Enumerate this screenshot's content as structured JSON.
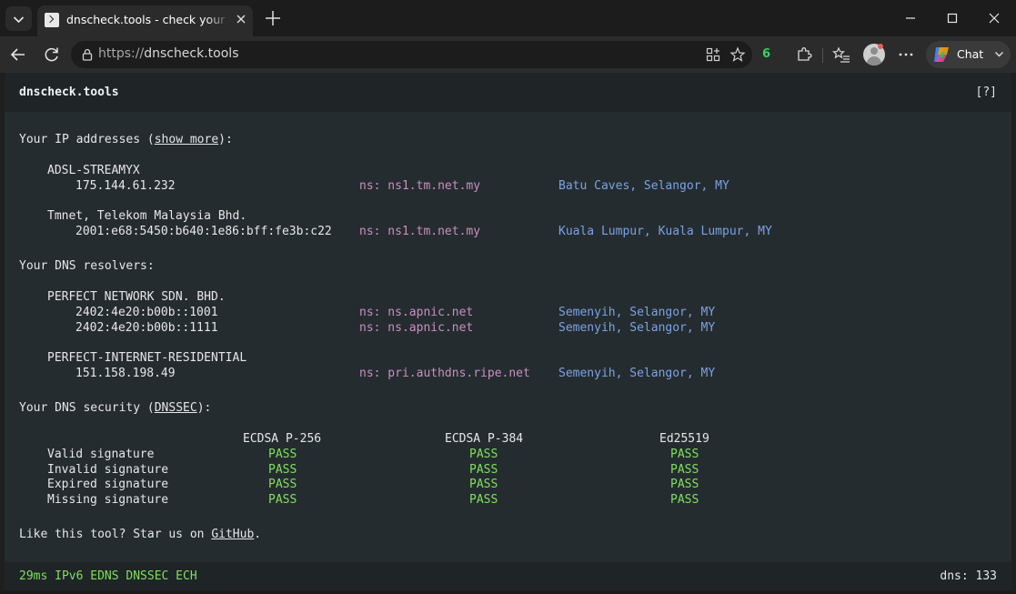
{
  "browser": {
    "tab_title": "dnscheck.tools - check your dns resolvers",
    "url_scheme": "https://",
    "url_host": "dnscheck.tools",
    "extension_badge": "6",
    "chat_label": "Chat"
  },
  "site": {
    "title": "dnscheck.tools",
    "help": "[?]"
  },
  "ip_section": {
    "heading_prefix": "Your IP addresses (",
    "heading_link": "show more",
    "heading_suffix": "):",
    "groups": [
      {
        "org": "ADSL-STREAMYX",
        "entries": [
          {
            "addr": "175.144.61.232",
            "ns": "ns: ns1.tm.net.my",
            "location": "Batu Caves, Selangor, MY"
          }
        ]
      },
      {
        "org": "Tmnet, Telekom Malaysia Bhd.",
        "entries": [
          {
            "addr": "2001:e68:5450:b640:1e86:bff:fe3b:c22",
            "ns": "ns: ns1.tm.net.my",
            "location": "Kuala Lumpur, Kuala Lumpur, MY"
          }
        ]
      }
    ]
  },
  "resolver_section": {
    "heading": "Your DNS resolvers:",
    "groups": [
      {
        "org": "PERFECT NETWORK SDN. BHD.",
        "entries": [
          {
            "addr": "2402:4e20:b00b::1001",
            "ns": "ns: ns.apnic.net",
            "location": "Semenyih, Selangor, MY"
          },
          {
            "addr": "2402:4e20:b00b::1111",
            "ns": "ns: ns.apnic.net",
            "location": "Semenyih, Selangor, MY"
          }
        ]
      },
      {
        "org": "PERFECT-INTERNET-RESIDENTIAL",
        "entries": [
          {
            "addr": "151.158.198.49",
            "ns": "ns: pri.authdns.ripe.net",
            "location": "Semenyih, Selangor, MY"
          }
        ]
      }
    ]
  },
  "security_section": {
    "heading_prefix": "Your DNS security (",
    "heading_link": "DNSSEC",
    "heading_suffix": "):",
    "algorithms": [
      "ECDSA P-256",
      "ECDSA P-384",
      "Ed25519"
    ],
    "rows": [
      {
        "label": "Valid signature",
        "results": [
          "PASS",
          "PASS",
          "PASS"
        ]
      },
      {
        "label": "Invalid signature",
        "results": [
          "PASS",
          "PASS",
          "PASS"
        ]
      },
      {
        "label": "Expired signature",
        "results": [
          "PASS",
          "PASS",
          "PASS"
        ]
      },
      {
        "label": "Missing signature",
        "results": [
          "PASS",
          "PASS",
          "PASS"
        ]
      }
    ]
  },
  "promo": {
    "prefix": "Like this tool? Star us on ",
    "link": "GitHub",
    "suffix": "."
  },
  "status_bar": {
    "left": "29ms IPv6 EDNS DNSSEC ECH",
    "right": "dns: 133"
  },
  "colors": {
    "page_bg": "#252c30",
    "pass": "#7ee05b",
    "ns": "#c98ec0",
    "location": "#7aa2e3"
  }
}
